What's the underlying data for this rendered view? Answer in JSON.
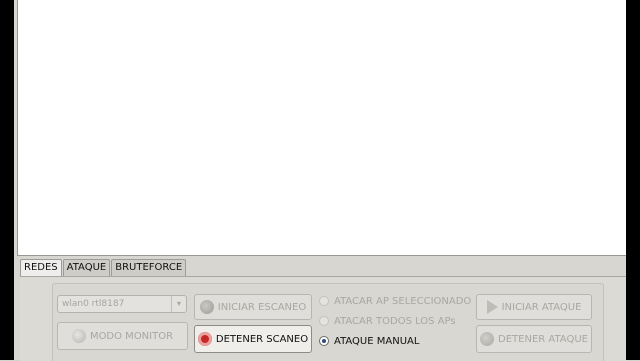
{
  "tabs": [
    "REDES",
    "ATAQUE",
    "BRUTEFORCE"
  ],
  "interface_select": {
    "value": "wlan0 rtl8187"
  },
  "buttons": {
    "modo_monitor": "MODO MONITOR",
    "iniciar_escaneo": "INICIAR ESCANEO",
    "detener_scaneo": "DETENER SCANEO",
    "iniciar_ataque": "INICIAR ATAQUE",
    "detener_ataque": "DETENER ATAQUE"
  },
  "attack_options": [
    {
      "label": "ATACAR AP SELECCIONADO",
      "selected": false
    },
    {
      "label": "ATACAR TODOS LOS APs",
      "selected": false
    },
    {
      "label": "ATAQUE MANUAL",
      "selected": true
    }
  ],
  "colors": {
    "accent": "#2c4d80",
    "stop_icon": "#c62828",
    "disabled_text": "#a9a7a2"
  },
  "icons": {
    "monitor": "lightbulb-icon",
    "scan": "scan-icon",
    "stop": "stop-icon",
    "play": "play-icon"
  }
}
